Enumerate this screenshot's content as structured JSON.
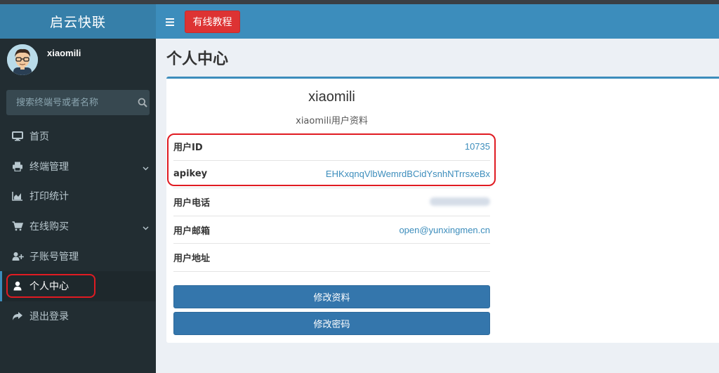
{
  "sidebar": {
    "logo": "启云快联",
    "user_name": "xiaomili",
    "search_placeholder": "搜索终端号或者名称",
    "items": [
      {
        "label": "首页"
      },
      {
        "label": "终端管理"
      },
      {
        "label": "打印统计"
      },
      {
        "label": "在线购买"
      },
      {
        "label": "子账号管理"
      },
      {
        "label": "个人中心"
      },
      {
        "label": "退出登录"
      }
    ]
  },
  "header": {
    "button_label": "有线教程"
  },
  "page": {
    "title": "个人中心",
    "profile_name": "xiaomili",
    "profile_subtitle": "xiaomili用户资料"
  },
  "info": [
    {
      "label": "用户ID",
      "value": "10735"
    },
    {
      "label": "apikey",
      "value": "EHKxqnqVlbWemrdBCidYsnhNTrrsxeBx"
    },
    {
      "label": "用户电话",
      "value": ""
    },
    {
      "label": "用户邮箱",
      "value": "open@yunxingmen.cn"
    },
    {
      "label": "用户地址",
      "value": ""
    }
  ],
  "buttons": {
    "edit_profile": "修改资料",
    "change_password": "修改密码"
  },
  "colors": {
    "sidebar_bg": "#222d32",
    "header_bg": "#3c8dbc",
    "logo_bg": "#367fa9",
    "tutorial_button": "#dd3333",
    "action_button": "#3476ac",
    "highlight_border": "#e01b22"
  }
}
